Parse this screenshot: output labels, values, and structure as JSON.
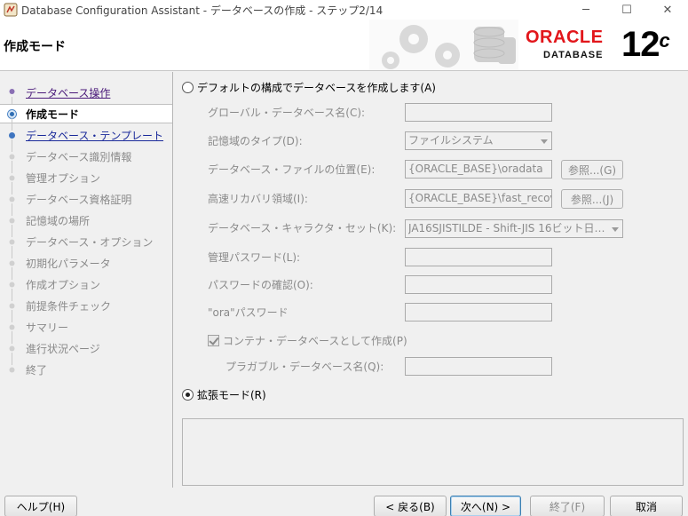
{
  "window": {
    "title": "Database Configuration Assistant - データベースの作成 - ステップ2/14",
    "minimize": "─",
    "maximize": "☐",
    "close": "✕"
  },
  "header": {
    "title": "作成モード",
    "logo_word": "ORACLE",
    "logo_sub": "DATABASE",
    "logo_version": "12",
    "logo_version_suffix": "c"
  },
  "nav": {
    "items": [
      {
        "label": "データベース操作",
        "state": "link"
      },
      {
        "label": "作成モード",
        "state": "current"
      },
      {
        "label": "データベース・テンプレート",
        "state": "link2"
      },
      {
        "label": "データベース識別情報",
        "state": "disabled"
      },
      {
        "label": "管理オプション",
        "state": "disabled"
      },
      {
        "label": "データベース資格証明",
        "state": "disabled"
      },
      {
        "label": "記憶域の場所",
        "state": "disabled"
      },
      {
        "label": "データベース・オプション",
        "state": "disabled"
      },
      {
        "label": "初期化パラメータ",
        "state": "disabled"
      },
      {
        "label": "作成オプション",
        "state": "disabled"
      },
      {
        "label": "前提条件チェック",
        "state": "disabled"
      },
      {
        "label": "サマリー",
        "state": "disabled"
      },
      {
        "label": "進行状況ページ",
        "state": "disabled"
      },
      {
        "label": "終了",
        "state": "disabled"
      }
    ]
  },
  "main": {
    "default_mode_label": "デフォルトの構成でデータベースを作成します(A)",
    "advanced_mode_label": "拡張モード(R)",
    "global_db_name_label": "グローバル・データベース名(C):",
    "global_db_name_value": "",
    "storage_type_label": "記憶域のタイプ(D):",
    "storage_type_value": "ファイルシステム",
    "db_file_location_label": "データベース・ファイルの位置(E):",
    "db_file_location_value": "{ORACLE_BASE}\\oradata",
    "browse_g": "参照...(G)",
    "recovery_area_label": "高速リカバリ領域(I):",
    "recovery_area_value": "{ORACLE_BASE}\\fast_recove",
    "browse_j": "参照...(J)",
    "charset_label": "データベース・キャラクタ・セット(K):",
    "charset_value": "JA16SJISTILDE - Shift-JIS 16ビット日本...",
    "admin_password_label": "管理パスワード(L):",
    "confirm_password_label": "パスワードの確認(O):",
    "ora_password_label": "\"ora\"パスワード",
    "container_db_label": "コンテナ・データベースとして作成(P)",
    "pluggable_db_label": "プラガブル・データベース名(Q):"
  },
  "footer": {
    "help": "ヘルプ(H)",
    "back": "< 戻る(B)",
    "next": "次へ(N) >",
    "finish": "終了(F)",
    "cancel": "取消"
  }
}
